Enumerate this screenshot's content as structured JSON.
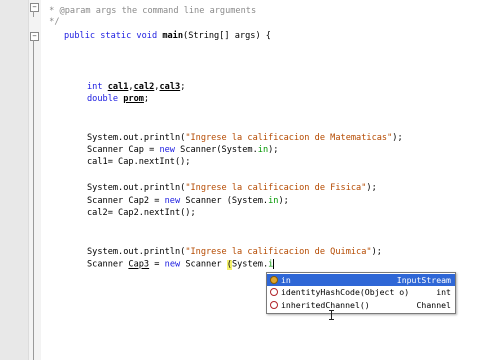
{
  "editor": {
    "line_numbers": [
      "",
      "",
      "",
      "",
      "",
      "",
      "",
      "",
      "",
      "",
      "",
      "",
      "",
      "",
      "",
      "",
      "",
      "",
      "",
      "",
      "",
      "",
      "",
      "",
      "",
      "",
      "",
      "",
      "",
      "",
      "",
      "",
      "",
      ""
    ],
    "comment_line_1": " * @param args the command line arguments",
    "comment_line_2": " */",
    "main_sig": {
      "public_static_void": "public static void ",
      "name": "main",
      "params": "(String[] args) {"
    },
    "decl_int_kw": "int ",
    "decl_int_vars": [
      "cal1",
      "cal2",
      "cal3"
    ],
    "decl_double_kw": "double ",
    "decl_double_var": "prom",
    "block1": {
      "println": "System.out.println(",
      "string": "\"Ingrese la calificacion de Matematicas\"",
      "end": ");",
      "scanner": "Scanner Cap = ",
      "new_kw": "new",
      "scanner_rest": " Scanner(System.",
      "in": "in",
      "scanner_end": ");",
      "assign": "cal1= Cap.nextInt();"
    },
    "block2": {
      "println": "System.out.println(",
      "string": "\"Ingrese la calificacion de Fisica\"",
      "end": ");",
      "scanner": "Scanner Cap2 = ",
      "new_kw": "new",
      "scanner_rest": " Scanner (System.",
      "in": "in",
      "scanner_end": ");",
      "assign": "cal2= Cap2.nextInt();"
    },
    "block3": {
      "println": "System.out.println(",
      "string": "\"Ingrese la calificacion de Quimica\"",
      "end": ");",
      "scanner_a": "Scanner ",
      "scanner_var": "Cap3",
      "scanner_b": " = ",
      "new_kw": "new",
      "scanner_c": " Scanner ",
      "paren": "(",
      "system": "System.",
      "typed": "i"
    }
  },
  "autocomplete": {
    "items": [
      {
        "name": "in",
        "type": "InputStream",
        "kind": "field",
        "selected": true
      },
      {
        "name": "identityHashCode(Object o)",
        "type": "int",
        "kind": "method",
        "selected": false
      },
      {
        "name": "inheritedChannel()",
        "type": "Channel",
        "kind": "method",
        "selected": false
      }
    ]
  }
}
